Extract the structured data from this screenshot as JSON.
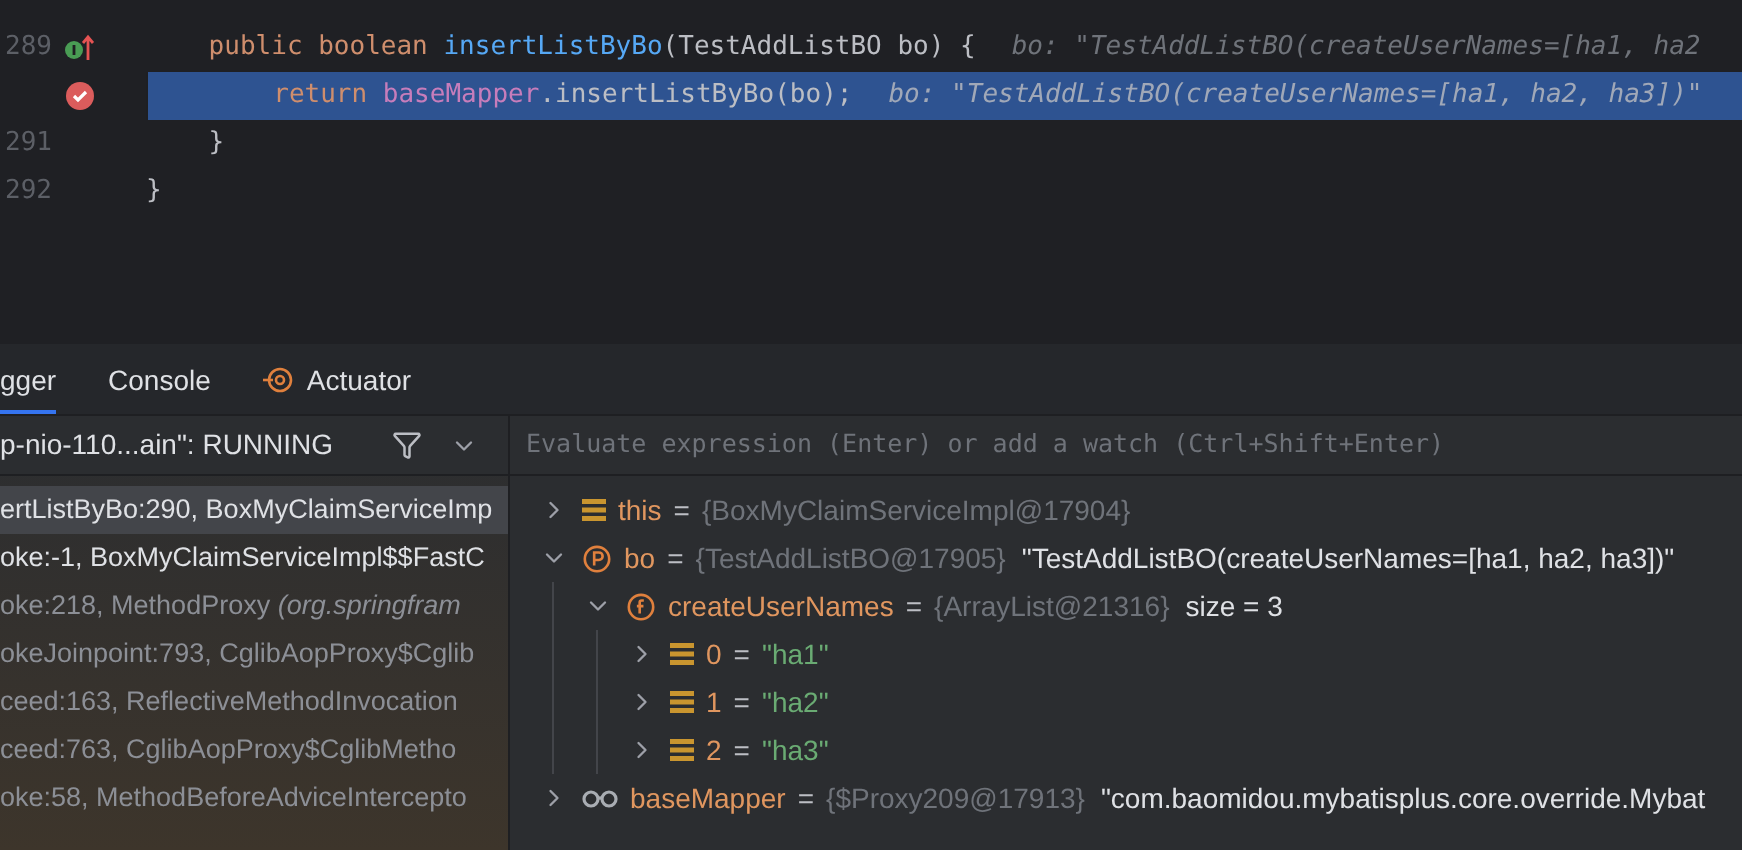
{
  "editor": {
    "lines": [
      {
        "number": "289",
        "kind": "override",
        "current": false,
        "tokens": [
          {
            "text": "    public boolean ",
            "kind": "keyword"
          },
          {
            "text": "insertListByBo",
            "kind": "method"
          },
          {
            "text": "(TestAddListBO bo) {",
            "kind": "plain"
          }
        ],
        "hint": "bo: \"TestAddListBO(createUserNames=[ha1, ha2"
      },
      {
        "kind": "breakpoint",
        "current": true,
        "tokens": [
          {
            "text": "        return ",
            "kind": "keyword"
          },
          {
            "text": "baseMapper",
            "kind": "field"
          },
          {
            "text": ".insertListByBo(bo);",
            "kind": "plain"
          }
        ],
        "hint": "bo: \"TestAddListBO(createUserNames=[ha1, ha2, ha3])\""
      },
      {
        "number": "291",
        "kind": "plain",
        "current": false,
        "tokens": [
          {
            "text": "    }",
            "kind": "plain"
          }
        ]
      },
      {
        "number": "292",
        "kind": "plain",
        "current": false,
        "tokens": [
          {
            "text": "}",
            "kind": "plain"
          }
        ]
      }
    ]
  },
  "debug_tabs": [
    {
      "label": "gger",
      "selected": true,
      "kind": "plain"
    },
    {
      "label": "Console",
      "selected": false,
      "kind": "plain"
    },
    {
      "label": "Actuator",
      "selected": false,
      "kind": "plugin"
    }
  ],
  "thread": {
    "label": "p-nio-110...ain\": RUNNING"
  },
  "evaluate": {
    "placeholder": "Evaluate expression (Enter) or add a watch (Ctrl+Shift+Enter)"
  },
  "frames": [
    {
      "location": "ertListByBo:290, BoxMyClaimServiceImp",
      "selected": true,
      "library": false
    },
    {
      "location": "oke:-1, BoxMyClaimServiceImpl$$FastC",
      "selected": false,
      "library": false
    },
    {
      "location": "oke:218, MethodProxy ",
      "package": "(org.springfram",
      "selected": false,
      "library": true
    },
    {
      "location": "okeJoinpoint:793, CglibAopProxy$Cglib",
      "selected": false,
      "library": true
    },
    {
      "location": "ceed:163, ReflectiveMethodInvocation",
      "selected": false,
      "library": true
    },
    {
      "location": "ceed:763, CglibAopProxy$CglibMetho",
      "selected": false,
      "library": true
    },
    {
      "location": "oke:58, MethodBeforeAdviceIntercepto",
      "selected": false,
      "library": true
    }
  ],
  "variables": [
    {
      "kind": "object",
      "name": "this",
      "equals": "=",
      "type": "{BoxMyClaimServiceImpl@17904}",
      "expanded": false
    },
    {
      "kind": "parameter",
      "name": "bo",
      "equals": "=",
      "type": "{TestAddListBO@17905}",
      "value": "\"TestAddListBO(createUserNames=[ha1, ha2, ha3])\"",
      "expanded": true,
      "children": [
        {
          "kind": "field",
          "name": "createUserNames",
          "equals": "=",
          "type": "{ArrayList@21316}",
          "value": "size = 3",
          "expanded": true,
          "children": [
            {
              "kind": "element",
              "name": "0",
              "equals": "=",
              "value": "\"ha1\"",
              "expanded": false
            },
            {
              "kind": "element",
              "name": "1",
              "equals": "=",
              "value": "\"ha2\"",
              "expanded": false
            },
            {
              "kind": "element",
              "name": "2",
              "equals": "=",
              "value": "\"ha3\"",
              "expanded": false
            }
          ]
        }
      ]
    },
    {
      "kind": "watch",
      "name": "baseMapper",
      "equals": "=",
      "type": "{$Proxy209@17913}",
      "value": "\"com.baomidou.mybatisplus.core.override.Mybat",
      "expanded": false
    }
  ]
}
